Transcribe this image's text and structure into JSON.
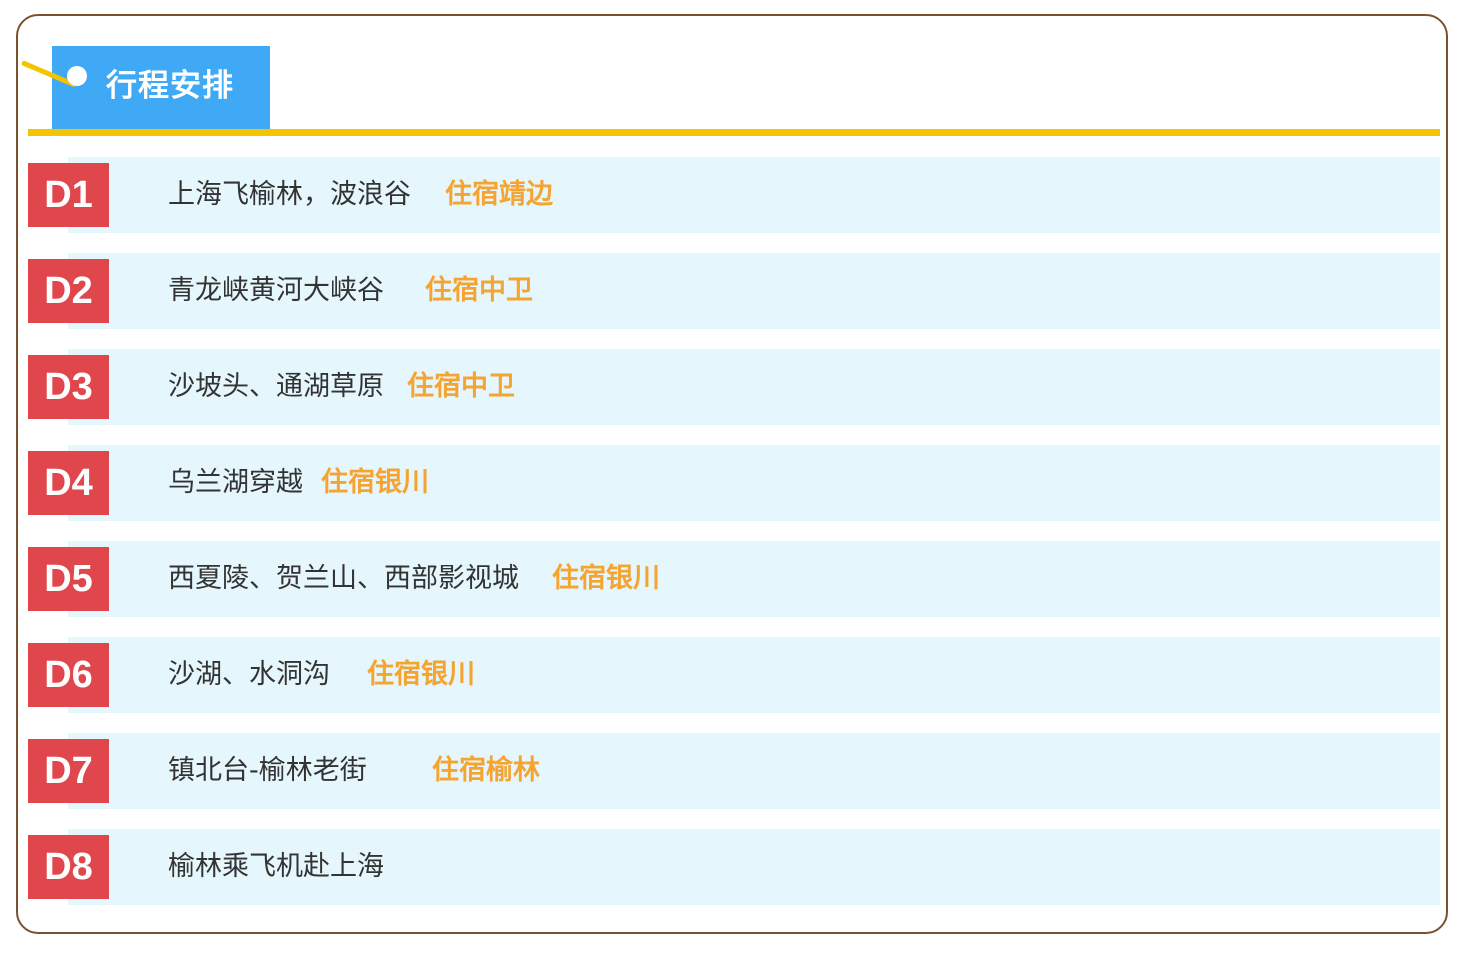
{
  "header": {
    "title": "行程安排"
  },
  "itinerary": [
    {
      "day": "D1",
      "route": "上海飞榆林，波浪谷",
      "stay": "住宿靖边"
    },
    {
      "day": "D2",
      "route": "青龙峡黄河大峡谷",
      "stay": "住宿中卫"
    },
    {
      "day": "D3",
      "route": "沙坡头、通湖草原",
      "stay": "住宿中卫"
    },
    {
      "day": "D4",
      "route": "乌兰湖穿越",
      "stay": "住宿银川"
    },
    {
      "day": "D5",
      "route": "西夏陵、贺兰山、西部影视城",
      "stay": "住宿银川"
    },
    {
      "day": "D6",
      "route": "沙湖、水洞沟",
      "stay": "住宿银川"
    },
    {
      "day": "D7",
      "route": "镇北台-榆林老街",
      "stay": "住宿榆林"
    },
    {
      "day": "D8",
      "route": "榆林乘飞机赴上海",
      "stay": ""
    }
  ],
  "colors": {
    "frame_border": "#7a5230",
    "header_tab": "#3fa9f5",
    "header_rule": "#f5c400",
    "row_background": "#e5f7fc",
    "day_badge": "#e0474c",
    "route_text": "#333333",
    "stay_text": "#f5a431"
  }
}
